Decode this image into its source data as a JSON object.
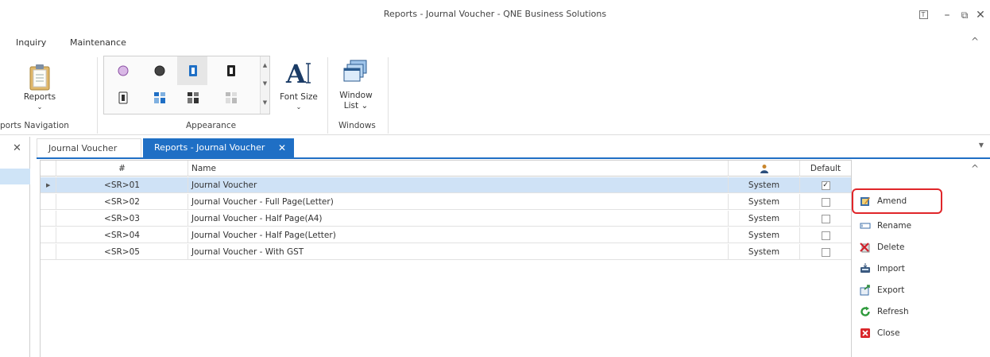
{
  "window": {
    "title": "Reports - Journal Voucher - QNE Business Solutions",
    "btn_help": "T",
    "btn_min": "–",
    "btn_restore": "⧉",
    "btn_close": "✕"
  },
  "menu": {
    "items": [
      "Inquiry",
      "Maintenance"
    ],
    "collapse": "^"
  },
  "ribbon": {
    "reports_label": "Reports",
    "reports_arrow": "⌄",
    "font_size_label": "Font Size",
    "font_size_arrow": "⌄",
    "window_list_line1": "Window",
    "window_list_line2": "List ⌄",
    "groups": {
      "navigation": "ports Navigation",
      "appearance": "Appearance",
      "windows": "Windows"
    }
  },
  "left_pane": {
    "close": "✕"
  },
  "tabs": [
    {
      "label": "Journal Voucher",
      "active": false
    },
    {
      "label": "Reports - Journal Voucher",
      "active": true,
      "close": "✕"
    }
  ],
  "tabs_dropdown": "▼",
  "grid": {
    "columns": {
      "num": "#",
      "name": "Name",
      "owner_icon": "user-icon",
      "default": "Default"
    },
    "rows": [
      {
        "num": "<SR>01",
        "name": "Journal Voucher",
        "owner": "System",
        "default": true,
        "selected": true
      },
      {
        "num": "<SR>02",
        "name": "Journal Voucher - Full Page(Letter)",
        "owner": "System",
        "default": false
      },
      {
        "num": "<SR>03",
        "name": "Journal Voucher - Half Page(A4)",
        "owner": "System",
        "default": false
      },
      {
        "num": "<SR>04",
        "name": "Journal Voucher - Half Page(Letter)",
        "owner": "System",
        "default": false
      },
      {
        "num": "<SR>05",
        "name": "Journal Voucher - With GST",
        "owner": "System",
        "default": false
      }
    ]
  },
  "actions": {
    "collapse": "^",
    "items": [
      {
        "label": "Amend",
        "icon": "amend-icon"
      },
      {
        "label": "Rename",
        "icon": "rename-icon"
      },
      {
        "label": "Delete",
        "icon": "delete-icon"
      },
      {
        "label": "Import",
        "icon": "import-icon"
      },
      {
        "label": "Export",
        "icon": "export-icon"
      },
      {
        "label": "Refresh",
        "icon": "refresh-icon"
      },
      {
        "label": "Close",
        "icon": "close-icon"
      }
    ]
  },
  "colors": {
    "accent": "#1f6fc5",
    "selection": "#cfe2f6",
    "highlight_box": "#e0262a"
  }
}
